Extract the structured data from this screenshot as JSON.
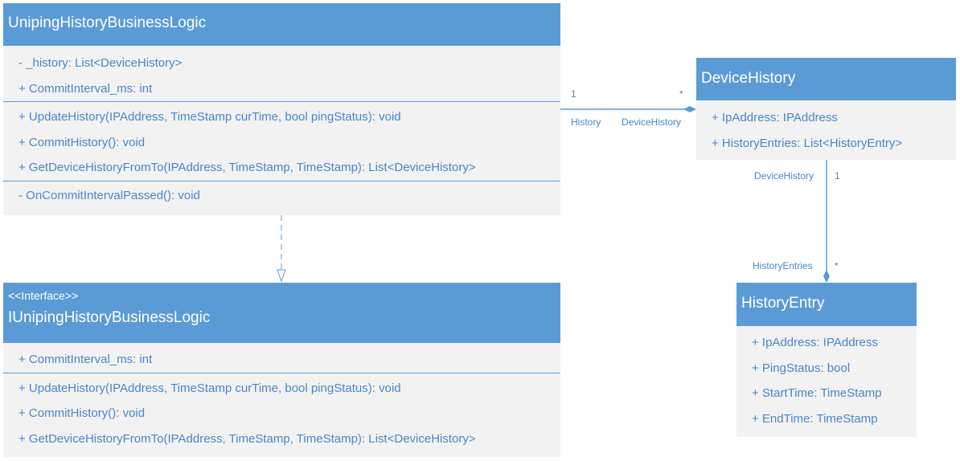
{
  "classes": {
    "business_logic": {
      "name": "UnipingHistoryBusinessLogic",
      "fields": [
        "- _history: List<DeviceHistory>",
        "+ CommitInterval_ms: int"
      ],
      "methods": [
        "+ UpdateHistory(IPAddress, TimeStamp curTime, bool pingStatus): void",
        "+ CommitHistory(): void",
        "+ GetDeviceHistoryFromTo(IPAddress, TimeStamp, TimeStamp): List<DeviceHistory>"
      ],
      "private_methods": [
        "- OnCommitIntervalPassed(): void"
      ]
    },
    "interface": {
      "stereotype": "<<Interface>>",
      "name": "IUnipingHistoryBusinessLogic",
      "fields": [
        "+ CommitInterval_ms: int"
      ],
      "methods": [
        "+ UpdateHistory(IPAddress, TimeStamp curTime, bool pingStatus): void",
        "+ CommitHistory(): void",
        "+ GetDeviceHistoryFromTo(IPAddress, TimeStamp, TimeStamp): List<DeviceHistory>"
      ]
    },
    "device_history": {
      "name": "DeviceHistory",
      "fields": [
        "+ IpAddress: IPAddress",
        "+ HistoryEntries: List<HistoryEntry>"
      ]
    },
    "history_entry": {
      "name": "HistoryEntry",
      "fields": [
        "+ IpAddress: IPAddress",
        "+ PingStatus: bool",
        "+ StartTime: TimeStamp",
        "+ EndTime: TimeStamp"
      ]
    }
  },
  "relations": {
    "history": {
      "source_multiplicity": "1",
      "target_multiplicity": "*",
      "source_role": "History",
      "target_role": "DeviceHistory"
    },
    "entries": {
      "source_multiplicity": "1",
      "target_multiplicity": "*",
      "source_role": "DeviceHistory",
      "target_role": "HistoryEntries"
    }
  },
  "colors": {
    "header": "#5b9bd5",
    "body": "#f2f2f2",
    "text": "#4a86c7"
  }
}
